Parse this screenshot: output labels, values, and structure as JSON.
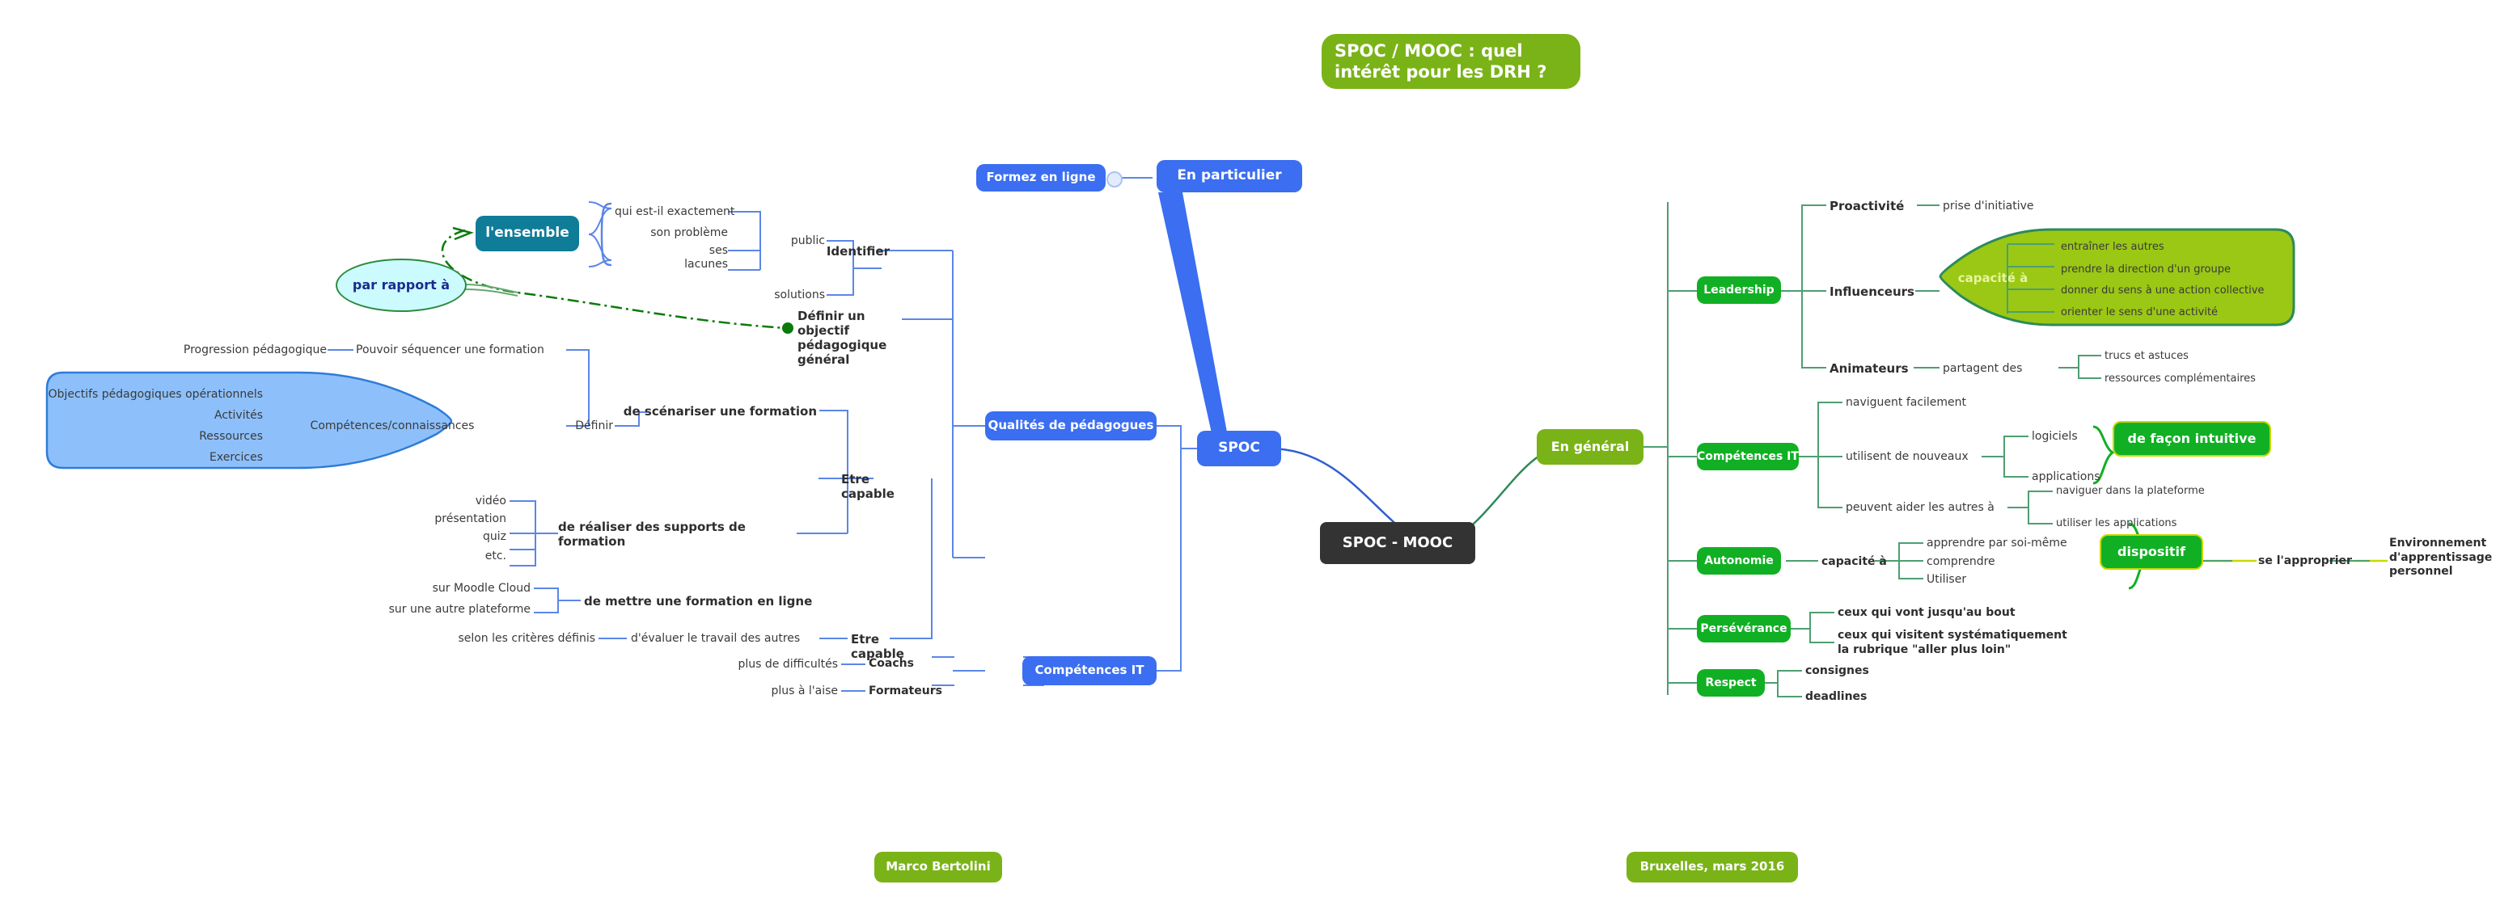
{
  "document": {
    "type": "mindmap",
    "title": "SPOC / MOOC : quel\nintérêt pour les DRH ?",
    "center": "SPOC - MOOC",
    "author": "Marco Bertolini",
    "place_date": "Bruxelles, mars 2016"
  },
  "colors": {
    "title_green": "#7ab317",
    "blue": "#3b6ef0",
    "teal": "#0f7c98",
    "dark": "#333333",
    "green": "#11b024",
    "olive": "#7ab317",
    "light_blue_balloon": "#8dc0fb",
    "green_balloon": "#9ac814",
    "cyan_ellipse": "#ccfbff",
    "blue_line": "#5b86e8",
    "green_line": "#4e9e72",
    "dark_green_line": "#0b7a0b",
    "yellow_line": "#c8d900"
  },
  "nodes": {
    "title": "SPOC / MOOC : quel\nintérêt pour les DRH ?",
    "formez_en_ligne": "Formez en ligne",
    "en_particulier": "En particulier",
    "spoc": "SPOC",
    "spoc_mooc": "SPOC - MOOC",
    "en_general": "En général",
    "qualites_de_pedagogues": "Qualités de pédagogues",
    "competences_it_blue": "Compétences IT",
    "lensemble": "l'ensemble",
    "par_rapport_a": "par rapport à",
    "leadership": "Leadership",
    "competences_it_green": "Compétences IT",
    "autonomie": "Autonomie",
    "perseverance": "Persévérance",
    "respect": "Respect",
    "de_facon_intuitive": "de façon intuitive",
    "dispositif": "dispositif",
    "capacite_a_balloon": "capacité à",
    "competences_connaissances": "Compétences/connaissances"
  },
  "left_branch": {
    "ensemble_children": [
      "qui est-il exactement",
      "son problème",
      "ses\nlacunes"
    ],
    "identifier": "Identifier",
    "identifier_children": [
      "public",
      "solutions"
    ],
    "definir_objectif": "Définir un objectif\npédagogique général",
    "progression_pedagogique": "Progression pédagogique",
    "pouvoir_sequencer": "Pouvoir séquencer une formation",
    "definir_1": "Définir",
    "balloon_items": [
      "Objectifs pédagogiques opérationnels",
      "Activités",
      "Ressources",
      "Exercices"
    ],
    "balloon_label": "Compétences/connaissances",
    "etre_capable_1": "Etre capable",
    "etre_capable_1_children": [
      "de scénariser une formation",
      "de réaliser des supports de formation",
      "de mettre une formation en ligne"
    ],
    "supports_children": [
      "vidéo",
      "présentation",
      "quiz",
      "etc."
    ],
    "mettre_en_ligne_children": [
      "sur Moodle Cloud",
      "sur une autre plateforme"
    ],
    "etre_capable_2": "Etre capable",
    "evaluer": "d'évaluer le travail des autres",
    "selon_criteres": "selon les critères définis",
    "coachs": "Coachs",
    "coachs_detail": "plus de difficultés",
    "formateurs": "Formateurs",
    "formateurs_detail": "plus à l'aise"
  },
  "right_branch": {
    "leadership_children": [
      "Proactivité",
      "Influenceurs",
      "Animateurs"
    ],
    "proactivite_child": "prise d'initiative",
    "influenceurs_child": "capacité à",
    "capacite_a_items": [
      "entraîner les autres",
      "prendre la direction d'un groupe",
      "donner du sens à une action collective",
      "orienter le sens d'une activité"
    ],
    "animateurs_child": "partagent des",
    "animateurs_items": [
      "trucs et astuces",
      "ressources complémentaires"
    ],
    "competences_it_children": [
      "naviguent facilement",
      "utilisent de nouveaux",
      "peuvent aider les autres à"
    ],
    "nouveaux_items": [
      "logiciels",
      "applications"
    ],
    "intuitive": "de façon intuitive",
    "aider_items": [
      "naviguer dans la plateforme",
      "utiliser les applications"
    ],
    "autonomie_child": "capacité à",
    "autonomie_items": [
      "apprendre par soi-même",
      "comprendre",
      "Utiliser"
    ],
    "dispositif": "dispositif",
    "se_lapproprier": "se l'approprier",
    "environnement": "Environnement\nd'apprentissage\npersonnel",
    "perseverance_items": [
      "ceux qui vont jusqu'au bout",
      "ceux qui visitent systématiquement\nla rubrique \"aller plus loin\""
    ],
    "respect_items": [
      "consignes",
      "deadlines"
    ]
  },
  "footer": {
    "author": "Marco Bertolini",
    "place_date": "Bruxelles, mars 2016"
  }
}
